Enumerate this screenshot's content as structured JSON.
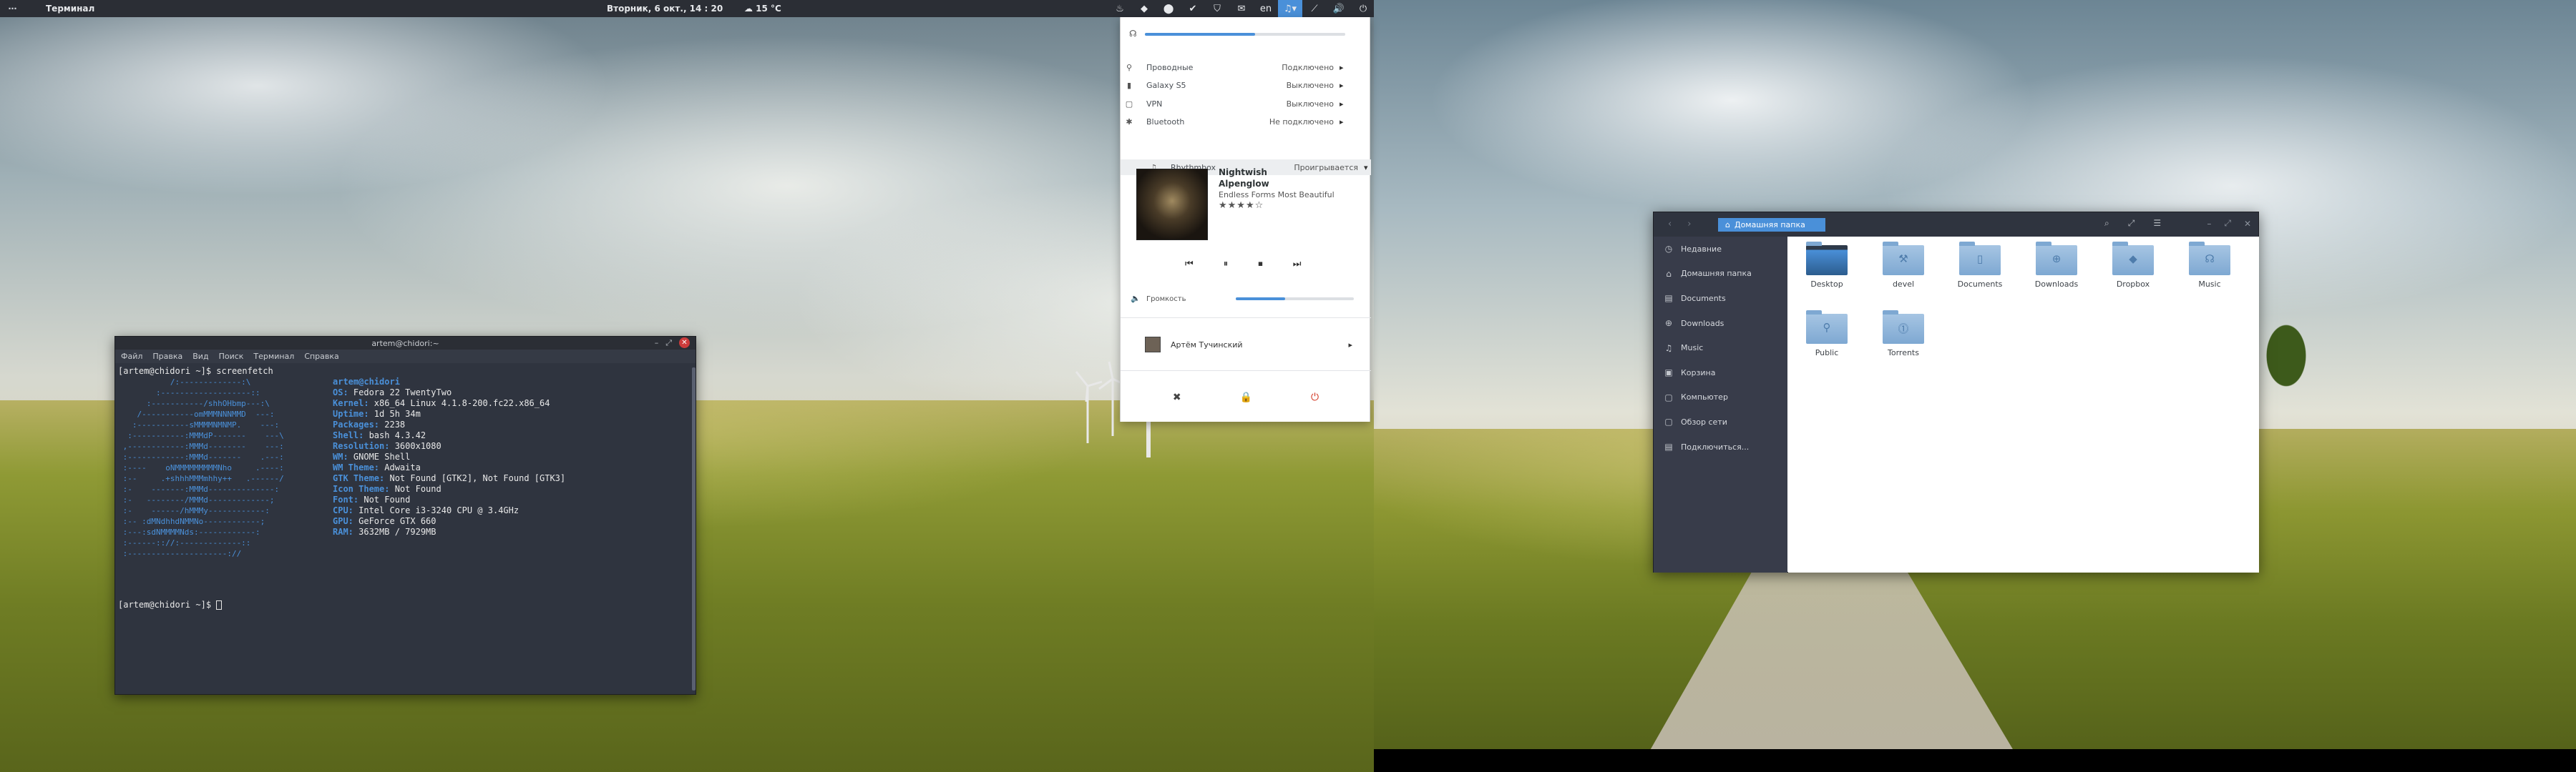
{
  "top_panel": {
    "activities": "⋯",
    "app_name": "Терминал",
    "clock": "Вторник, 6 окт., 14 : 20",
    "weather": "☁ 15 °C",
    "tray": [
      {
        "icon": "steam-icon",
        "glyph": "♨"
      },
      {
        "icon": "chat-icon",
        "glyph": "◆"
      },
      {
        "icon": "android-icon",
        "glyph": "⬤"
      },
      {
        "icon": "sync-icon",
        "glyph": "✔"
      },
      {
        "icon": "pocket-icon",
        "glyph": "⛉"
      },
      {
        "icon": "mail-icon",
        "glyph": "✉"
      },
      {
        "icon": "keyboard-layout-label",
        "glyph": "en"
      },
      {
        "icon": "music-note-icon",
        "glyph": "♫▾"
      },
      {
        "icon": "wifi-icon",
        "glyph": "⟋"
      },
      {
        "icon": "volume-icon",
        "glyph": "🔊"
      },
      {
        "icon": "power-icon",
        "glyph": "⏻"
      }
    ],
    "accent": "#4a90d9"
  },
  "terminal": {
    "title": "artem@chidori:~",
    "controls": [
      "–",
      "⤢",
      "✕"
    ],
    "menu": [
      "Файл",
      "Правка",
      "Вид",
      "Поиск",
      "Терминал",
      "Справка"
    ],
    "first_prompt": "[artem@chidori ~]$ screenfetch",
    "logo": "           /:-------------:\\\n        :-------------------::\n      :-----------/shhOHbmp---:\\\n    /-----------omMMMNNNMMD  ---:\n   :-----------sMMMMNMNMP.    ---:\n  :-----------:MMMdP-------    ---\\\n ,------------:MMMd--------    ---:\n :------------:MMMd-------    .---:\n :----    oNMMMMMMMMMNho     .----:\n :--     .+shhhMMMmhhy++   .------/\n :-    -------:MMMd--------------:\n :-   --------/MMMd-------------;\n :-    ------/hMMMy------------:\n :-- :dMNdhhdNMMNo------------;\n :---:sdNMMMMNds:------------:\n :------:://:-------------::\n :---------------------://",
    "info": [
      {
        "k": "artem@chidori",
        "v": ""
      },
      {
        "k": "OS:",
        "v": " Fedora 22 TwentyTwo"
      },
      {
        "k": "Kernel:",
        "v": " x86_64 Linux 4.1.8-200.fc22.x86_64"
      },
      {
        "k": "Uptime:",
        "v": " 1d 5h 34m"
      },
      {
        "k": "Packages:",
        "v": " 2238"
      },
      {
        "k": "Shell:",
        "v": " bash 4.3.42"
      },
      {
        "k": "Resolution:",
        "v": " 3600x1080"
      },
      {
        "k": "WM:",
        "v": " GNOME Shell"
      },
      {
        "k": "WM Theme:",
        "v": " Adwaita"
      },
      {
        "k": "GTK Theme:",
        "v": " Not Found [GTK2], Not Found [GTK3]"
      },
      {
        "k": "Icon Theme:",
        "v": " Not Found"
      },
      {
        "k": "Font:",
        "v": " Not Found"
      },
      {
        "k": "CPU:",
        "v": " Intel Core i3-3240 CPU @ 3.4GHz"
      },
      {
        "k": "GPU:",
        "v": " GeForce GTX 660"
      },
      {
        "k": "RAM:",
        "v": " 3632MB / 7929MB"
      }
    ],
    "last_prompt": "[artem@chidori ~]$ "
  },
  "system_menu": {
    "top_volume_level": 0.55,
    "network": [
      {
        "icon": "wired-icon",
        "label": "Проводные",
        "value": "Подключено"
      },
      {
        "icon": "phone-icon",
        "label": "Galaxy S5",
        "value": "Выключено"
      },
      {
        "icon": "vpn-icon",
        "label": "VPN",
        "value": "Выключено"
      },
      {
        "icon": "bluetooth-icon",
        "label": "Bluetooth",
        "value": "Не подключено"
      }
    ],
    "player": {
      "label": "Rhythmbox",
      "status": "Проигрывается",
      "track": "Nightwish",
      "artist": "Alpenglow",
      "album": "Endless Forms Most Beautiful",
      "rating": "★★★★☆",
      "rating_value": 4,
      "controls": [
        "⏮",
        "⏸",
        "⏹",
        "⏭"
      ]
    },
    "volume_label": "Громкость",
    "volume_level": 0.42,
    "user": "Артём Тучинский",
    "actions": [
      "settings-icon",
      "lock-icon",
      "power-off-icon"
    ],
    "action_glyphs": [
      "✖",
      "🔒",
      "⏻"
    ]
  },
  "files": {
    "nav": [
      "‹",
      "›"
    ],
    "location": "Домашняя папка",
    "tools": [
      "⌕",
      "⤢",
      "☰"
    ],
    "window_controls": [
      "–",
      "⤢",
      "✕"
    ],
    "sidebar": [
      {
        "icon": "clock-icon",
        "glyph": "◷",
        "label": "Недавние"
      },
      {
        "icon": "home-icon",
        "glyph": "⌂",
        "label": "Домашняя папка"
      },
      {
        "icon": "documents-icon",
        "glyph": "▤",
        "label": "Documents"
      },
      {
        "icon": "downloads-icon",
        "glyph": "⊕",
        "label": "Downloads"
      },
      {
        "icon": "music-icon",
        "glyph": "♫",
        "label": "Music"
      },
      {
        "icon": "trash-icon",
        "glyph": "▣",
        "label": "Корзина"
      },
      {
        "icon": "computer-icon",
        "glyph": "▢",
        "label": "Компьютер"
      },
      {
        "icon": "network-icon",
        "glyph": "▢",
        "label": "Обзор сети"
      },
      {
        "icon": "server-icon",
        "glyph": "▤",
        "label": "Подключиться..."
      }
    ],
    "folders": [
      {
        "name": "Desktop",
        "glyph": "",
        "icon": "desktop-folder-icon"
      },
      {
        "name": "devel",
        "glyph": "⚒",
        "icon": "devel-folder-icon"
      },
      {
        "name": "Documents",
        "glyph": "▯",
        "icon": "documents-folder-icon"
      },
      {
        "name": "Downloads",
        "glyph": "⊕",
        "icon": "downloads-folder-icon"
      },
      {
        "name": "Dropbox",
        "glyph": "◆",
        "icon": "dropbox-folder-icon"
      },
      {
        "name": "Music",
        "glyph": "☊",
        "icon": "music-folder-icon"
      },
      {
        "name": "Public",
        "glyph": "⚲",
        "icon": "public-folder-icon"
      },
      {
        "name": "Torrents",
        "glyph": "⓵",
        "icon": "torrents-folder-icon"
      }
    ]
  }
}
